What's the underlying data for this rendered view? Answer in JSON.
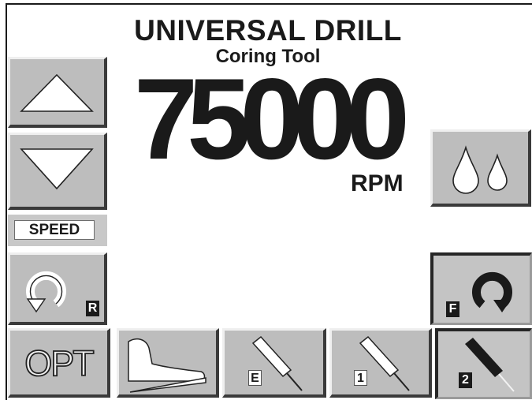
{
  "header": {
    "title": "UNIVERSAL DRILL",
    "subtitle": "Coring Tool"
  },
  "display": {
    "speed_value": "75000",
    "speed_unit": "RPM"
  },
  "left_panel": {
    "speed_label": "SPEED",
    "reverse_badge": "R",
    "opt_label": "OPT"
  },
  "right_panel": {
    "forward_badge": "F"
  },
  "bottom_bar": {
    "tool_e_badge": "E",
    "tool_1_badge": "1",
    "tool_2_badge": "2"
  },
  "colors": {
    "button_face": "#bdbdbd",
    "bevel_light": "#efefef",
    "bevel_dark": "#3a3a3a",
    "ink": "#1a1a1a"
  }
}
